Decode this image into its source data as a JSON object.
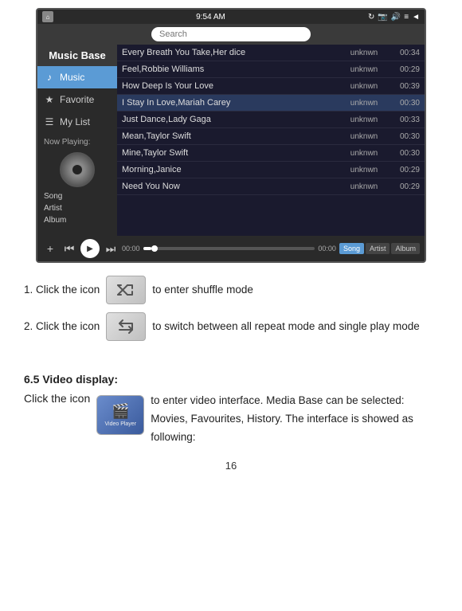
{
  "app": {
    "title": "Music Base",
    "time": "9:54 AM"
  },
  "sidebar": {
    "title": "Music Base",
    "items": [
      {
        "id": "music",
        "label": "Music",
        "icon": "♪",
        "active": true
      },
      {
        "id": "favorite",
        "label": "Favorite",
        "icon": "★"
      },
      {
        "id": "mylist",
        "label": "My List",
        "icon": "☰"
      }
    ],
    "now_playing_label": "Now Playing:",
    "song_info": {
      "song": "Song",
      "artist": "Artist",
      "album": "Album"
    }
  },
  "songs": [
    {
      "title": "Every Breath You Take,Her dice",
      "artist": "unknwn",
      "duration": "00:34"
    },
    {
      "title": "Feel,Robbie Williams",
      "artist": "unknwn",
      "duration": "00:29"
    },
    {
      "title": "How Deep Is Your Love",
      "artist": "unknwn",
      "duration": "00:39"
    },
    {
      "title": "I Stay In Love,Mariah Carey",
      "artist": "unknwn",
      "duration": "00:30",
      "highlighted": true
    },
    {
      "title": "Just Dance,Lady Gaga",
      "artist": "unknwn",
      "duration": "00:33"
    },
    {
      "title": "Mean,Taylor Swift",
      "artist": "unknwn",
      "duration": "00:30"
    },
    {
      "title": "Mine,Taylor Swift",
      "artist": "unknwn",
      "duration": "00:30"
    },
    {
      "title": "Morning,Janice",
      "artist": "unknwn",
      "duration": "00:29"
    },
    {
      "title": "Need You Now",
      "artist": "unknwn",
      "duration": "00:29"
    }
  ],
  "playback": {
    "time_start": "00:00",
    "time_end": "00:00",
    "progress_percent": 5,
    "view_buttons": [
      "Song",
      "Artist",
      "Album"
    ],
    "active_view": "Song"
  },
  "instructions": {
    "step1_prefix": "1. Click the icon",
    "step1_suffix": "to enter shuffle mode",
    "step2_prefix": "2. Click the icon",
    "step2_suffix": "to switch between all repeat mode and single play mode",
    "section_heading": "6.5 Video display:",
    "video_prefix": "Click the icon",
    "video_suffix": "to enter video interface. Media Base can be selected: Movies, Favourites, History. The interface is showed as following:",
    "video_player_label": "Video Player"
  },
  "page_number": "16"
}
